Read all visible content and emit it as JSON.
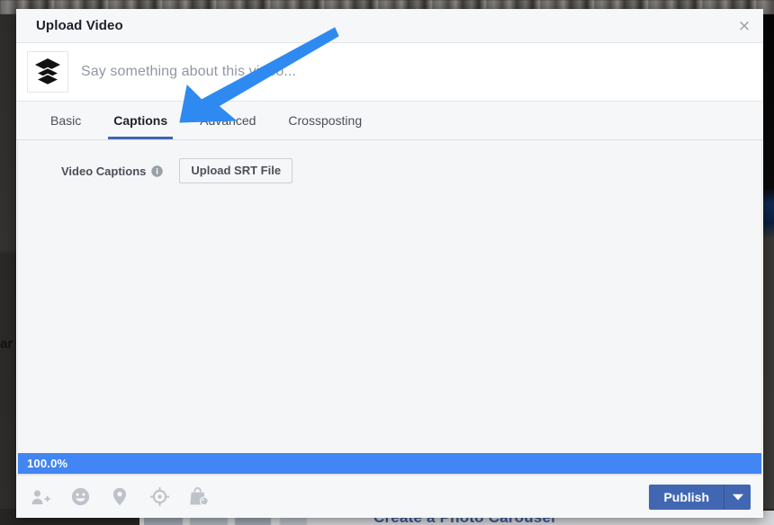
{
  "window": {
    "title": "Upload Video",
    "close_label": "×",
    "close_icon": "close-icon"
  },
  "composer": {
    "avatar_icon": "layers-stack-logo",
    "placeholder": "Say something about this video...",
    "value": ""
  },
  "tabs": {
    "items": [
      {
        "label": "Basic",
        "active": false
      },
      {
        "label": "Captions",
        "active": true
      },
      {
        "label": "Advanced",
        "active": false
      },
      {
        "label": "Crossposting",
        "active": false
      }
    ],
    "active_index": 1,
    "active_underline_color": "#4267b2"
  },
  "panel": {
    "field_label": "Video Captions",
    "info_icon": "info-icon",
    "upload_button_label": "Upload SRT File"
  },
  "progress": {
    "text": "100.0%",
    "percent": 100,
    "bar_color": "#4285f4"
  },
  "footer": {
    "icons": [
      {
        "name": "tag-people-icon",
        "title": "Tag People"
      },
      {
        "name": "emoji-icon",
        "title": "Feeling/Activity"
      },
      {
        "name": "location-pin-icon",
        "title": "Check In"
      },
      {
        "name": "target-icon",
        "title": "Target Audience"
      },
      {
        "name": "product-tag-icon",
        "title": "Tag Products"
      }
    ],
    "publish_label": "Publish",
    "publish_caret_icon": "chevron-down-icon",
    "publish_color": "#4267b2"
  },
  "annotation": {
    "arrow_color": "#2e8af0",
    "points_to": "Captions"
  },
  "backdrop": {
    "carousel_text": "Create a Photo Carousel",
    "left_text": "ar e"
  }
}
